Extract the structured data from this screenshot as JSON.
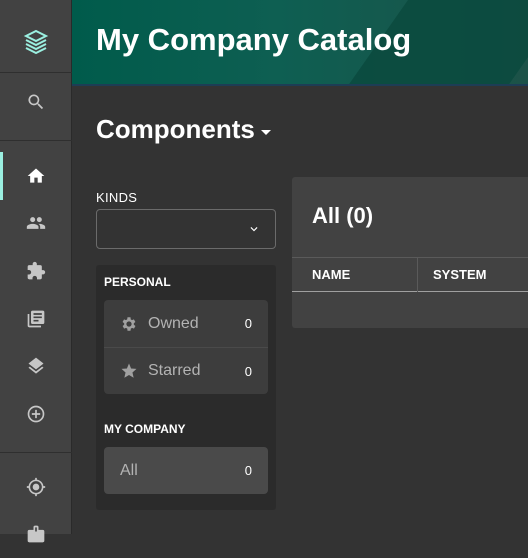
{
  "sidebar": {
    "logo": "stacked-layers-logo",
    "items": [
      {
        "name": "search-icon"
      },
      {
        "name": "home-icon"
      },
      {
        "name": "people-icon"
      },
      {
        "name": "puzzle-icon"
      },
      {
        "name": "library-books-icon"
      },
      {
        "name": "layers-icon"
      },
      {
        "name": "add-circle-icon"
      },
      {
        "name": "target-icon"
      },
      {
        "name": "badge-icon"
      }
    ],
    "active_color": "#9bf0e1"
  },
  "header": {
    "title": "My Company Catalog"
  },
  "page": {
    "title": "Components"
  },
  "filters": {
    "kinds_label": "KINDS",
    "personal_label": "PERSONAL",
    "personal_items": [
      {
        "label": "Owned",
        "count": "0",
        "icon": "gear-icon"
      },
      {
        "label": "Starred",
        "count": "0",
        "icon": "star-icon"
      }
    ],
    "company_label": "MY COMPANY",
    "company_items": [
      {
        "label": "All",
        "count": "0"
      }
    ]
  },
  "table": {
    "title": "All (0)",
    "columns": [
      "NAME",
      "SYSTEM"
    ]
  }
}
